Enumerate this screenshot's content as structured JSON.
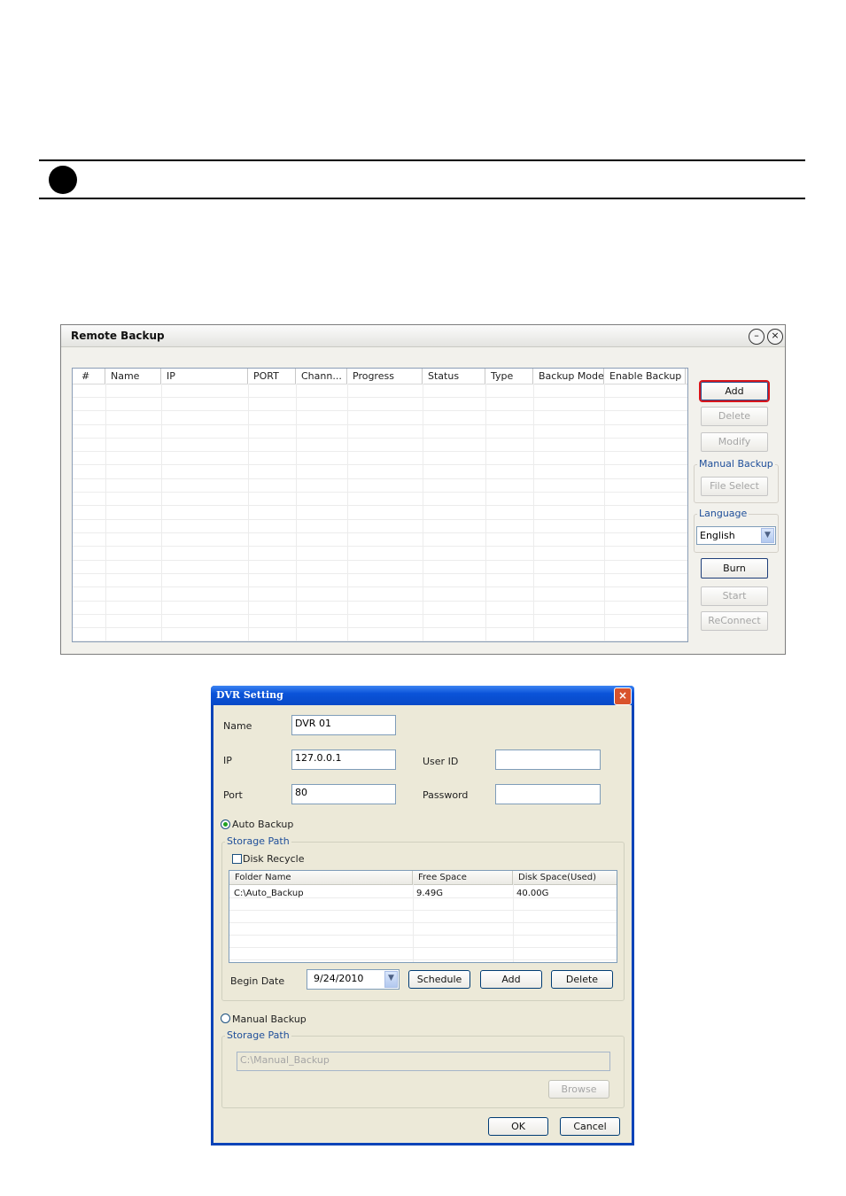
{
  "remote_backup": {
    "title": "Remote Backup",
    "minimize_glyph": "–",
    "close_glyph": "×",
    "columns": [
      "#",
      "Name",
      "IP",
      "PORT",
      "Chann...",
      "Progress",
      "Status",
      "Type",
      "Backup Mode",
      "Enable Backup"
    ],
    "buttons": {
      "add": "Add",
      "delete": "Delete",
      "modify": "Modify",
      "file_select": "File Select",
      "burn": "Burn",
      "start": "Start",
      "reconnect": "ReConnect"
    },
    "manual_backup_group": "Manual Backup",
    "language_group": "Language",
    "language_value": "English"
  },
  "dvr_setting": {
    "title": "DVR Setting",
    "close_glyph": "×",
    "name_label": "Name",
    "name_value": "DVR 01",
    "ip_label": "IP",
    "ip_value": "127.0.0.1",
    "port_label": "Port",
    "port_value": "80",
    "user_id_label": "User ID",
    "user_id_value": "",
    "password_label": "Password",
    "password_value": "",
    "auto_backup_label": "Auto Backup",
    "auto_backup_selected": true,
    "storage_path_label": "Storage Path",
    "disk_recycle_label": "Disk Recycle",
    "disk_recycle_checked": false,
    "table_columns": [
      "Folder Name",
      "Free Space",
      "Disk Space(Used)"
    ],
    "table_rows": [
      {
        "folder": "C:\\Auto_Backup",
        "free": "9.49G",
        "used": "40.00G"
      }
    ],
    "begin_date_label": "Begin Date",
    "begin_date_value": "9/24/2010",
    "schedule_button": "Schedule",
    "add_button": "Add",
    "delete_button": "Delete",
    "manual_backup_label": "Manual Backup",
    "manual_backup_selected": false,
    "manual_storage_path_label": "Storage Path",
    "manual_path_value": "C:\\Manual_Backup",
    "browse_button": "Browse",
    "ok_button": "OK",
    "cancel_button": "Cancel"
  },
  "colors": {
    "highlight_outline": "#d9141b",
    "xp_title_blue": "#0a53d9",
    "group_label_blue": "#1f4f9a"
  }
}
